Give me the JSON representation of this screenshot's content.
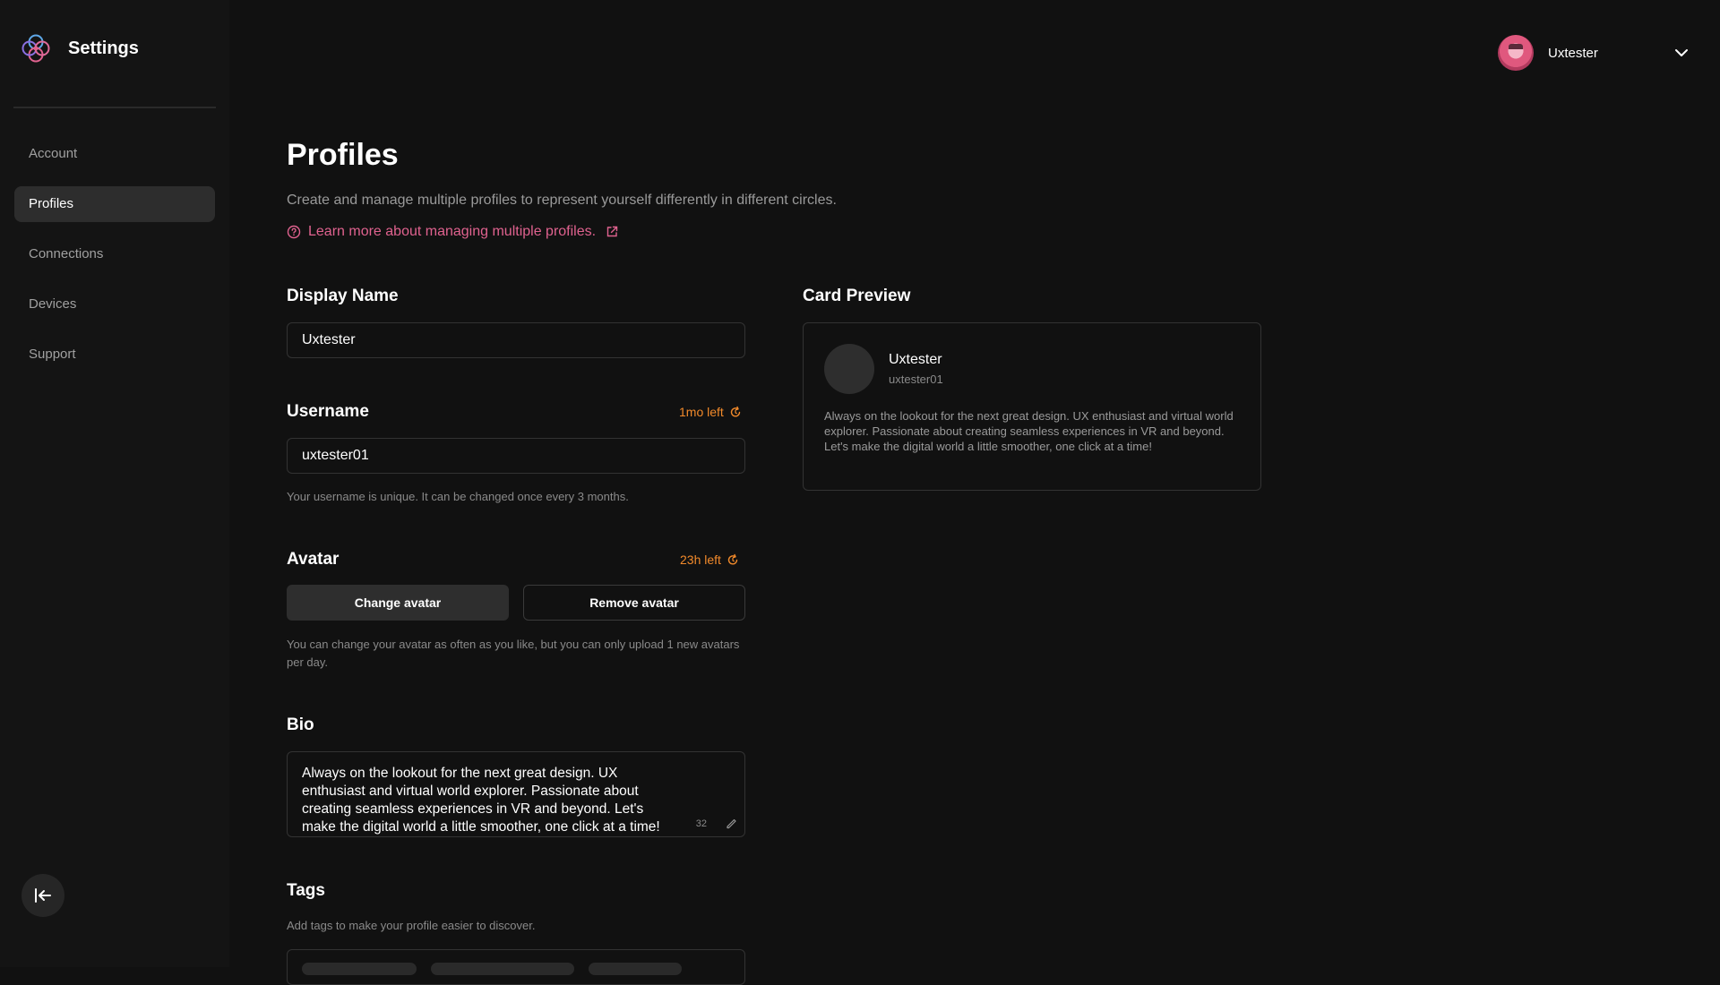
{
  "app": {
    "title": "Settings"
  },
  "sidebar": {
    "items": [
      {
        "label": "Account"
      },
      {
        "label": "Profiles",
        "active": true
      },
      {
        "label": "Connections"
      },
      {
        "label": "Devices"
      },
      {
        "label": "Support"
      }
    ]
  },
  "user": {
    "name": "Uxtester"
  },
  "page": {
    "title": "Profiles",
    "description": "Create and manage multiple profiles to represent yourself differently in different circles.",
    "learn_more": "Learn more about managing multiple profiles."
  },
  "display_name": {
    "label": "Display Name",
    "value": "Uxtester"
  },
  "username": {
    "label": "Username",
    "timer": "1mo left",
    "value": "uxtester01",
    "hint": "Your username is unique. It can be changed once every 3 months."
  },
  "avatar": {
    "label": "Avatar",
    "timer": "23h left",
    "change_label": "Change avatar",
    "remove_label": "Remove avatar",
    "hint": "You can change your avatar as often as you like, but you can only upload 1 new avatars per day."
  },
  "bio": {
    "label": "Bio",
    "value": "Always on the lookout for the next great design. UX enthusiast and virtual world explorer. Passionate about creating seamless experiences in VR and beyond. Let's make the digital world a little smoother, one click at a time!",
    "count": "32"
  },
  "tags": {
    "label": "Tags",
    "hint": "Add tags to make your profile easier to discover."
  },
  "card_preview": {
    "label": "Card Preview",
    "name": "Uxtester",
    "username": "uxtester01",
    "bio": "Always on the lookout for the next great design. UX enthusiast and virtual world explorer. Passionate about creating seamless experiences in VR and beyond. Let's make the digital world a little smoother, one click at a time!"
  },
  "colors": {
    "background": "#111111",
    "sidebar": "#141414",
    "accent_link": "#e0628f",
    "timer": "#f28a2b",
    "active_nav": "#2d2d2d"
  },
  "icons": {
    "brand": "flower-logo-icon",
    "chevron": "chevron-down-icon",
    "help": "help-circle-icon",
    "external": "external-link-icon",
    "timer": "timer-refresh-icon",
    "collapse": "collapse-sidebar-icon",
    "resize": "resize-handle-icon"
  }
}
